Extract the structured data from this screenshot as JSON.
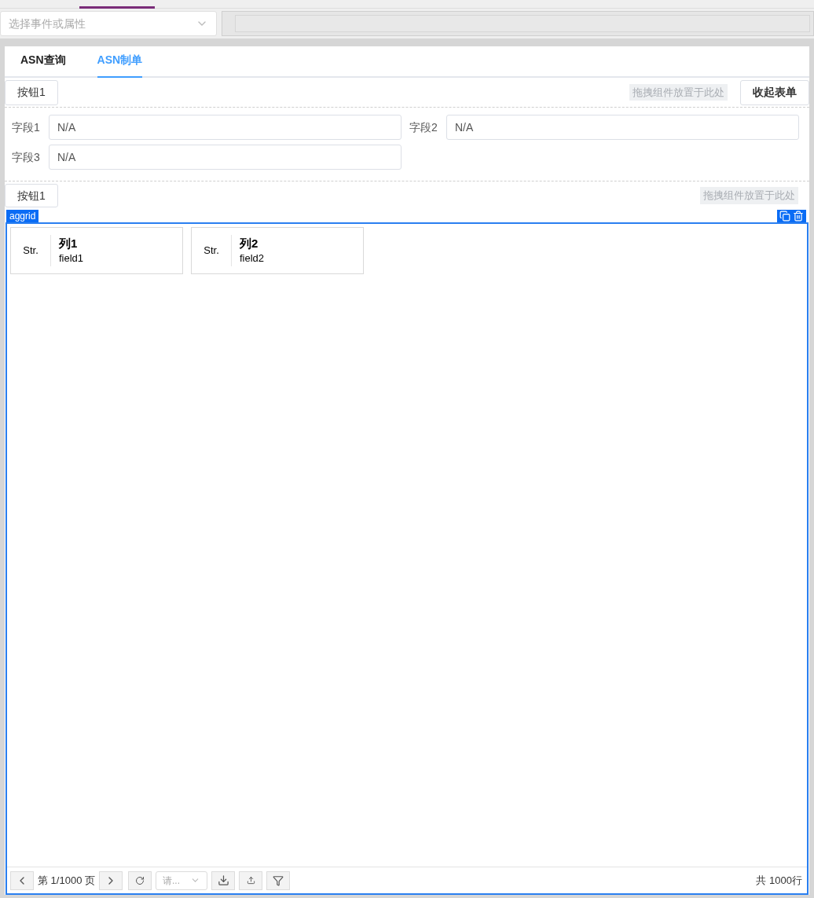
{
  "top_select": {
    "placeholder": "选择事件或属性"
  },
  "tabs": [
    {
      "label": "ASN查询",
      "selected": false
    },
    {
      "label": "ASN制单",
      "selected": true
    }
  ],
  "toolbar_1": {
    "button": "按钮1",
    "drop_zone": "拖拽组件放置于此处",
    "collapse_button": "收起表单"
  },
  "form_fields": [
    {
      "label": "字段1",
      "value": "N/A"
    },
    {
      "label": "字段2",
      "value": "N/A"
    },
    {
      "label": "字段3",
      "value": "N/A"
    }
  ],
  "toolbar_2": {
    "button": "按钮1",
    "drop_zone": "拖拽组件放置于此处"
  },
  "grid": {
    "tag": "aggrid",
    "columns": [
      {
        "type": "Str.",
        "title": "列1",
        "field": "field1"
      },
      {
        "type": "Str.",
        "title": "列2",
        "field": "field2"
      }
    ],
    "pager": {
      "page": "第 1/1000 页",
      "page_size_placeholder": "请...",
      "total": "共 1000行"
    }
  }
}
